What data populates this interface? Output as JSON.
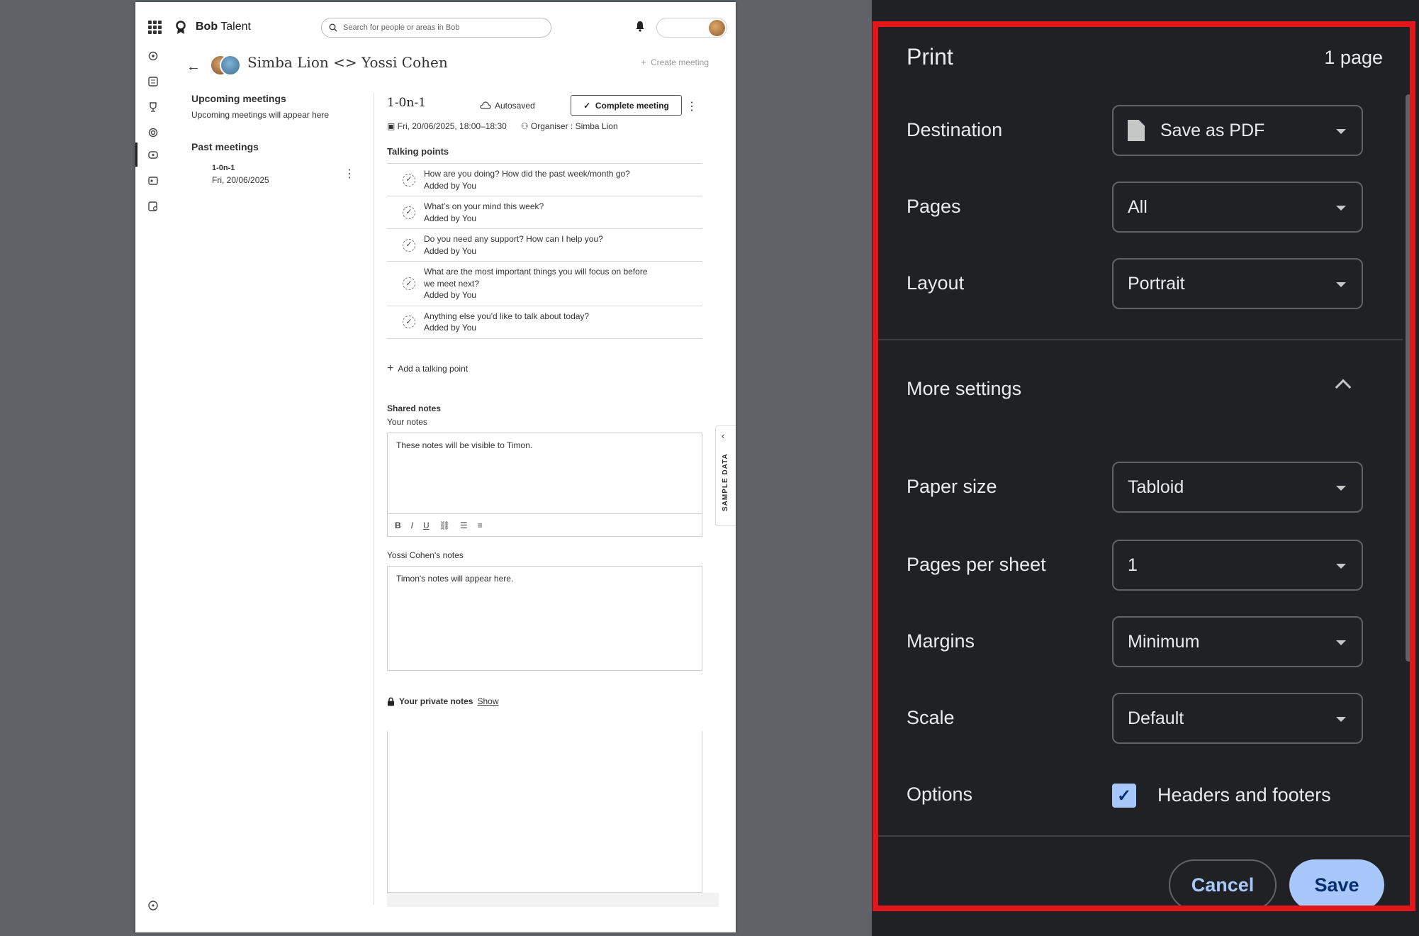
{
  "preview": {
    "brand_bold": "Bob",
    "brand_rest": " Talent",
    "search_placeholder": "Search for people or areas in Bob",
    "meeting_title": "Simba Lion <> Yossi Cohen",
    "create_meeting": "Create meeting",
    "upcoming_heading": "Upcoming meetings",
    "upcoming_sub": "Upcoming meetings will appear here",
    "past_heading": "Past meetings",
    "past_items": [
      {
        "title": "1-0n-1",
        "date": "Fri, 20/06/2025"
      }
    ],
    "main": {
      "title": "1-0n-1",
      "autosaved": "Autosaved",
      "complete_button": "Complete meeting",
      "date": "Fri, 20/06/2025, 18:00–18:30",
      "organiser": "Organiser : Simba Lion",
      "talking_points_heading": "Talking points",
      "talking_points": [
        {
          "question": "How are you doing? How did the past week/month go?",
          "added_by": "Added by You"
        },
        {
          "question": "What’s on your mind this week?",
          "added_by": "Added by You"
        },
        {
          "question": "Do you need any support? How can I help you?",
          "added_by": "Added by You"
        },
        {
          "question": "What are the most important things you will focus on before we meet next?",
          "added_by": "Added by You"
        },
        {
          "question": "Anything else you'd like to talk about today?",
          "added_by": "Added by You"
        }
      ],
      "add_talking_point": "Add a talking point",
      "shared_notes_heading": "Shared notes",
      "your_notes_label": "Your notes",
      "your_notes_text": "These notes will be visible to Timon.",
      "other_notes_label": "Yossi Cohen's notes",
      "other_notes_text": "Timon's notes will appear here.",
      "private_notes_label": "Your private notes",
      "private_notes_link": "Show"
    },
    "sample_data_tab": "SAMPLE DATA"
  },
  "print": {
    "title": "Print",
    "page_count": "1 page",
    "destination_label": "Destination",
    "destination_value": "Save as PDF",
    "pages_label": "Pages",
    "pages_value": "All",
    "layout_label": "Layout",
    "layout_value": "Portrait",
    "more_settings": "More settings",
    "paper_size_label": "Paper size",
    "paper_size_value": "Tabloid",
    "pages_per_sheet_label": "Pages per sheet",
    "pages_per_sheet_value": "1",
    "margins_label": "Margins",
    "margins_value": "Minimum",
    "scale_label": "Scale",
    "scale_value": "Default",
    "options_label": "Options",
    "headers_footers_label": "Headers and footers",
    "headers_footers_checked": true,
    "cancel_button": "Cancel",
    "save_button": "Save"
  },
  "colors": {
    "panel_bg": "#202124",
    "highlight_border": "#e3161c",
    "primary_button": "#a8c7fa",
    "backdrop": "#5f6368"
  }
}
